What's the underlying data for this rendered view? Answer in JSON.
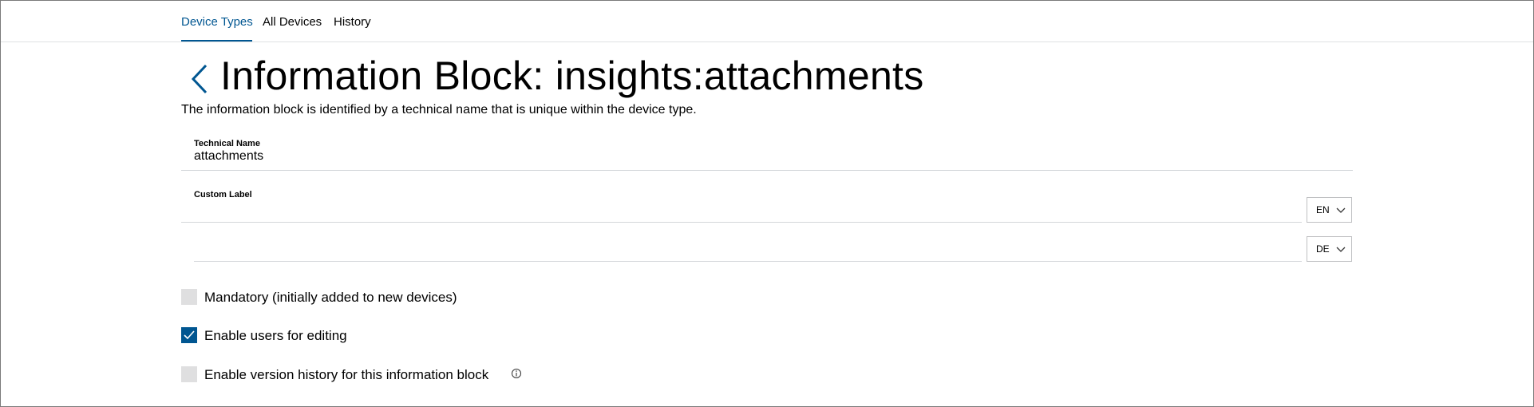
{
  "tabs": [
    {
      "label": "Device Types",
      "active": true
    },
    {
      "label": "All Devices",
      "active": false
    },
    {
      "label": "History",
      "active": false
    }
  ],
  "header": {
    "title": "Information Block: insights:attachments",
    "description": "The information block is identified by a technical name that is unique within the device type.",
    "back_icon": "chevron-left-icon"
  },
  "form": {
    "technical_name": {
      "label": "Technical Name",
      "value": "attachments"
    },
    "custom_label": {
      "label": "Custom Label",
      "languages": [
        {
          "code": "EN",
          "value": ""
        },
        {
          "code": "DE",
          "value": ""
        }
      ]
    },
    "options": [
      {
        "label": "Mandatory (initially added to new devices)",
        "checked": false
      },
      {
        "label": "Enable users for editing",
        "checked": true
      },
      {
        "label": "Enable version history for this information block",
        "checked": false,
        "info_icon": "info-icon"
      }
    ]
  },
  "colors": {
    "accent": "#005691",
    "checkbox_unchecked": "#dfdfe0",
    "divider": "#d4d7da"
  }
}
